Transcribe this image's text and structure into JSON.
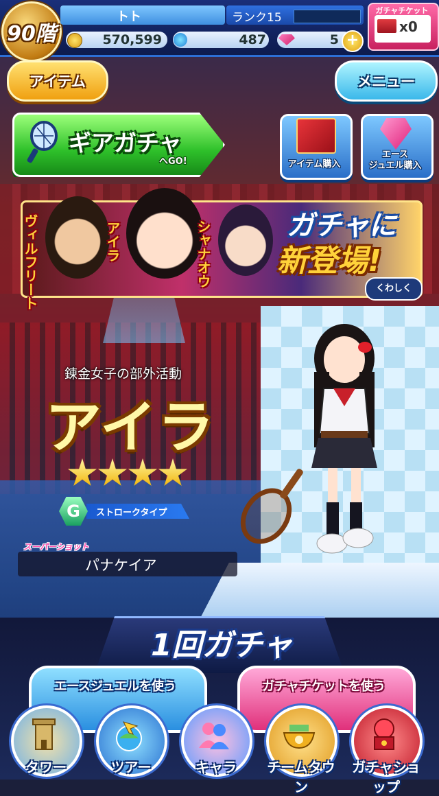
{
  "status": {
    "floor": "90階",
    "player_name": "トト",
    "rank": "ランク15",
    "coins": "570,599",
    "water": "487",
    "gems": "5",
    "add_label": "+",
    "gacha_ticket_label": "ガチャチケット",
    "gacha_ticket_count": "x0"
  },
  "header": {
    "item_button": "アイテム",
    "menu_button": "メニュー"
  },
  "shop": {
    "gear_gacha_label": "ギアガチャ",
    "gear_gacha_sub": "へGO!",
    "item_purchase": "アイテム購入",
    "ace_jewel_line1": "エース",
    "ace_jewel_line2": "ジュエル購入"
  },
  "banner": {
    "names": [
      "ヴィルフリート",
      "アイラ",
      "シャナオウ"
    ],
    "headline_line1": "ガチャに",
    "headline_line2": "新登場!",
    "details_button": "くわしく"
  },
  "character": {
    "subtitle": "錬金女子の部外活動",
    "name": "アイラ",
    "stars": 4,
    "type_badge": "G",
    "type_label": "ストロークタイプ",
    "super_shot_label": "スーパーショット",
    "super_shot_name": "パナケイア"
  },
  "gacha": {
    "title": "1回ガチャ",
    "use_jewel": "エースジュエルを使う",
    "use_ticket": "ガチャチケットを使う"
  },
  "nav": {
    "items": [
      {
        "label": "タワー",
        "icon": "tower-icon"
      },
      {
        "label": "ツアー",
        "icon": "globe-plane-icon"
      },
      {
        "label": "キャラ",
        "icon": "people-icon"
      },
      {
        "label": "チームタウン",
        "icon": "bowl-icon"
      },
      {
        "label": "ガチャショップ",
        "icon": "gacha-machine-icon"
      }
    ]
  },
  "colors": {
    "accent_blue": "#2d6fd6",
    "gold": "#f0a010",
    "gacha_pink": "#e0307a",
    "gear_green": "#2ec02a"
  }
}
